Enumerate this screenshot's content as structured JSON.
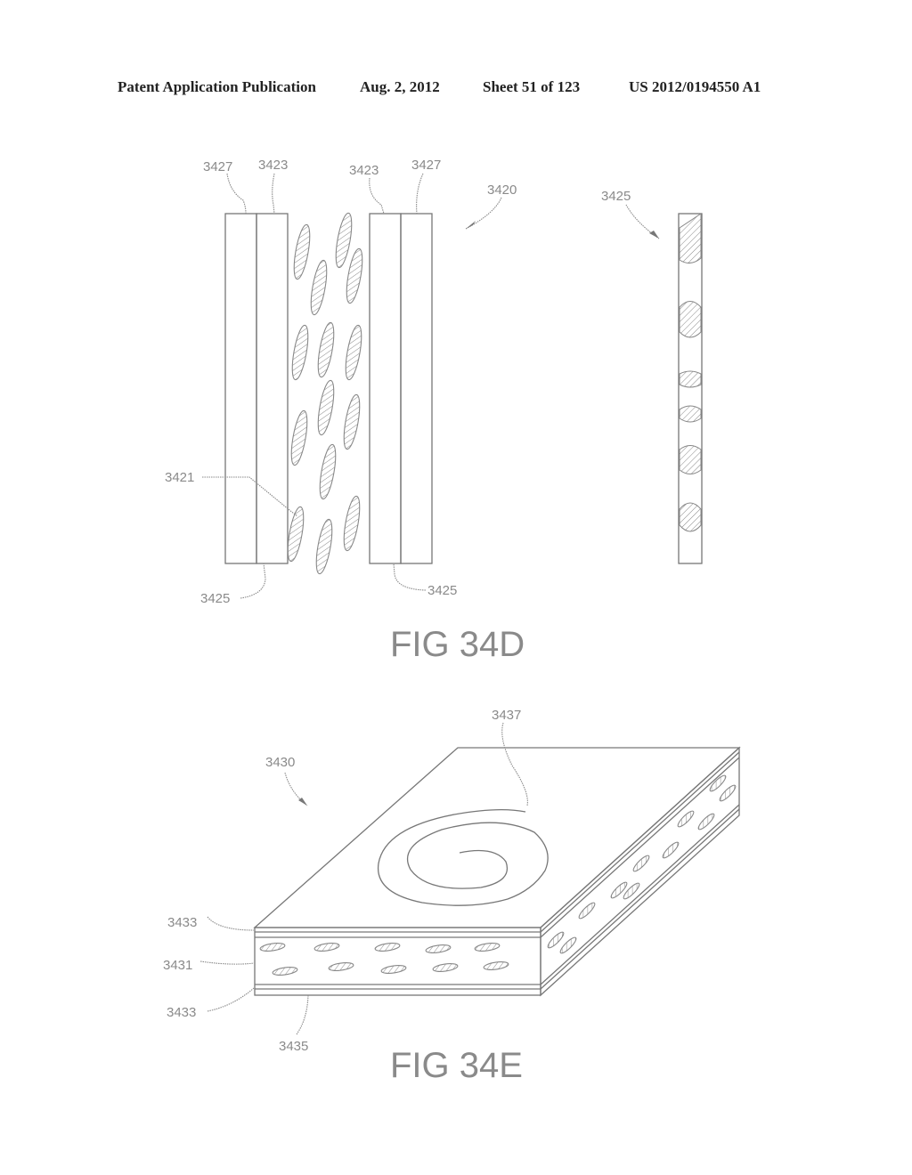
{
  "header": {
    "publication_type": "Patent Application Publication",
    "date": "Aug. 2, 2012",
    "sheet": "Sheet 51 of 123",
    "publication_number": "US 2012/0194550 A1"
  },
  "figure_34d": {
    "caption": "FIG 34D",
    "labels": {
      "left_outer_layer_top": "3427",
      "left_inner_layer_top": "3423",
      "right_inner_layer_top": "3423",
      "right_outer_layer_top": "3427",
      "assembly": "3420",
      "separate_layer": "3425",
      "particle": "3421",
      "left_bottom_layer": "3425",
      "right_bottom_layer": "3425"
    }
  },
  "figure_34e": {
    "caption": "FIG 34E",
    "labels": {
      "assembly": "3430",
      "spiral_element": "3437",
      "top_layer": "3433",
      "middle_layer": "3431",
      "bottom_layer": "3433",
      "base_surface": "3435"
    }
  }
}
